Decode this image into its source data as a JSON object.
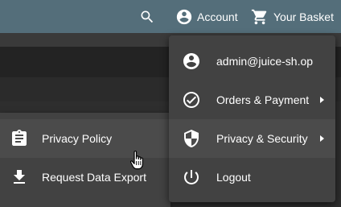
{
  "toolbar": {
    "account_label": "Account",
    "basket_label": "Your Basket",
    "icons": {
      "search": "search-icon",
      "account": "account-circle-icon",
      "basket": "shopping-cart-icon"
    }
  },
  "account_menu": {
    "items": [
      {
        "label": "admin@juice-sh.op",
        "icon": "account-circle-icon",
        "has_submenu": false
      },
      {
        "label": "Orders & Payment",
        "icon": "check-circle-icon",
        "has_submenu": true
      },
      {
        "label": "Privacy & Security",
        "icon": "shield-icon",
        "has_submenu": true
      },
      {
        "label": "Logout",
        "icon": "power-icon",
        "has_submenu": false
      }
    ]
  },
  "privacy_submenu": {
    "items": [
      {
        "label": "Privacy Policy",
        "icon": "clipboard-icon"
      },
      {
        "label": "Request Data Export",
        "icon": "download-icon"
      }
    ]
  },
  "colors": {
    "toolbar": "#546e7a",
    "menu_background": "#424242",
    "page_background": "#2f2f2f",
    "text": "#ffffff"
  }
}
